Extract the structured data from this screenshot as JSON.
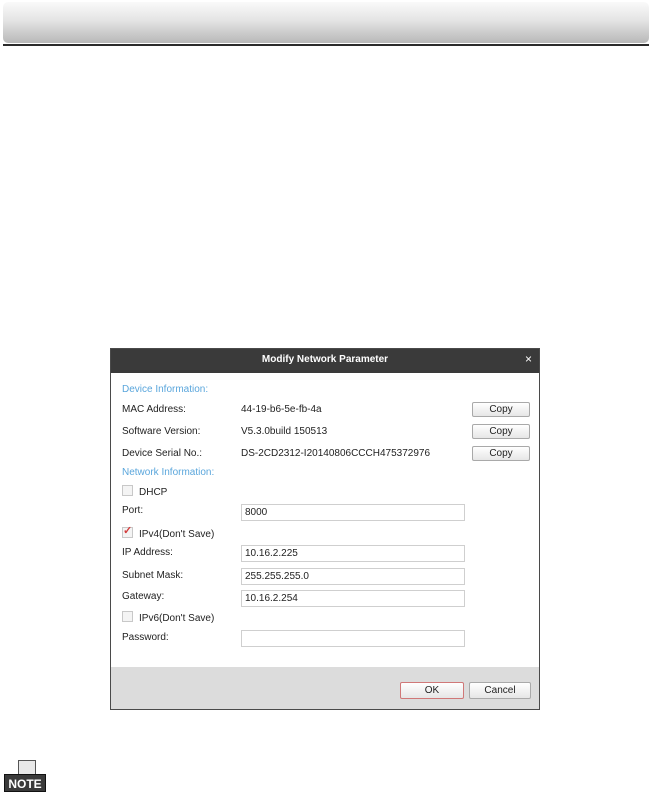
{
  "dialog": {
    "title": "Modify Network Parameter",
    "close_glyph": "×",
    "device_info_heading": "Device Information:",
    "mac_label": "MAC Address:",
    "mac_value": "44-19-b6-5e-fb-4a",
    "software_label": "Software Version:",
    "software_value": "V5.3.0build 150513",
    "serial_label": "Device Serial No.:",
    "serial_value": "DS-2CD2312-I20140806CCCH475372976",
    "copy_label": "Copy",
    "network_info_heading": "Network Information:",
    "dhcp_label": "DHCP",
    "dhcp_checked": false,
    "port_label": "Port:",
    "port_value": "8000",
    "ipv4_label": "IPv4(Don't Save)",
    "ipv4_checked": true,
    "ip_label": "IP Address:",
    "ip_value": "10.16.2.225",
    "subnet_label": "Subnet Mask:",
    "subnet_value": "255.255.255.0",
    "gateway_label": "Gateway:",
    "gateway_value": "10.16.2.254",
    "ipv6_label": "IPv6(Don't Save)",
    "ipv6_checked": false,
    "password_label": "Password:",
    "password_value": "",
    "ok_label": "OK",
    "cancel_label": "Cancel"
  },
  "note": {
    "label": "NOTE"
  },
  "colors": {
    "section_heading": "#5aa6dc",
    "titlebar": "#3a3a3a",
    "checkmark": "#d23c3c"
  }
}
